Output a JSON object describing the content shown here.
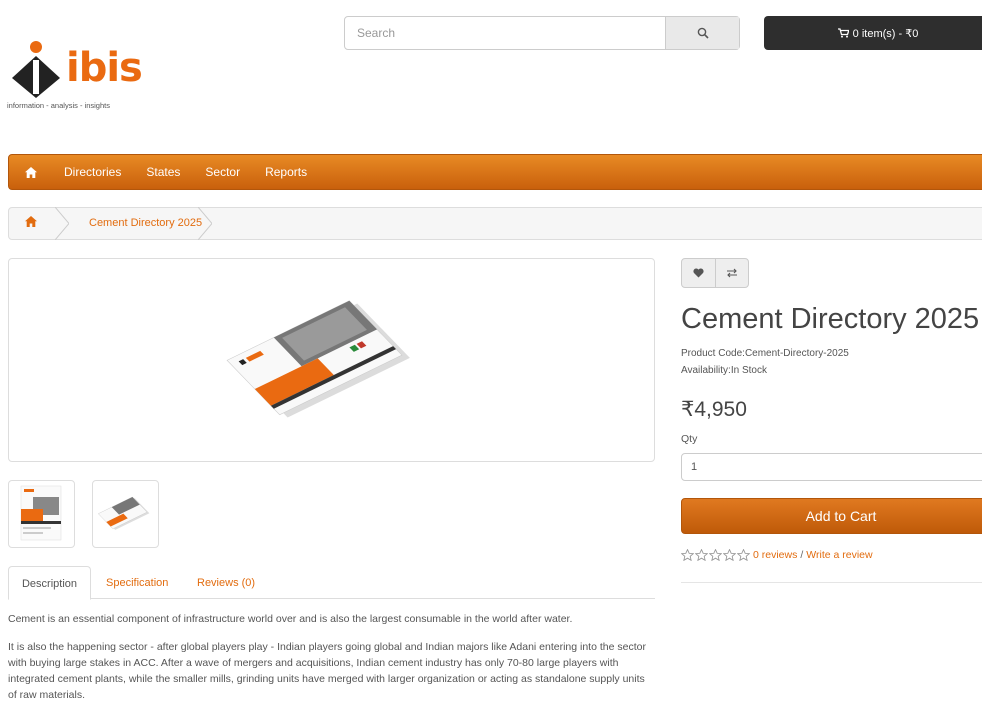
{
  "brand": {
    "name": "ibis",
    "tagline": "information - analysis - insights",
    "orange": "#ea6a11",
    "dark": "#222222"
  },
  "header": {
    "search_placeholder": "Search",
    "search_icon": "search-icon",
    "cart_icon": "shopping-cart-icon",
    "cart_label": "0 item(s) - ₹0"
  },
  "menu": {
    "home_icon": "home-icon",
    "items": [
      "Directories",
      "States",
      "Sector",
      "Reports"
    ]
  },
  "breadcrumb": {
    "home_icon": "home-icon",
    "current": "Cement Directory 2025"
  },
  "product": {
    "title": "Cement Directory 2025",
    "code_label": "Product Code:",
    "code": "Cement-Directory-2025",
    "availability_label": "Availability:",
    "availability": "In Stock",
    "price": "₹4,950",
    "qty_label": "Qty",
    "qty_value": "1",
    "add_to_cart": "Add to Cart",
    "wishlist_icon": "heart-icon",
    "compare_icon": "compare-arrows-icon",
    "rating": 0,
    "reviews_link": "0 reviews",
    "write_review": "Write a review"
  },
  "tabs": {
    "description": "Description",
    "specification": "Specification",
    "reviews": "Reviews (0)"
  },
  "description": [
    "Cement is an essential component of infrastructure world over and is also the largest consumable in the world after water.",
    "It is also the happening sector - after global players play - Indian players going global and Indian majors like Adani entering into the sector with buying large stakes in ACC.  After a wave of mergers and acquisitions, Indian cement industry has only 70-80 large players with integrated cement plants, while the smaller mills, grinding units have merged with larger organization or acting as standalone supply units of raw materials."
  ]
}
